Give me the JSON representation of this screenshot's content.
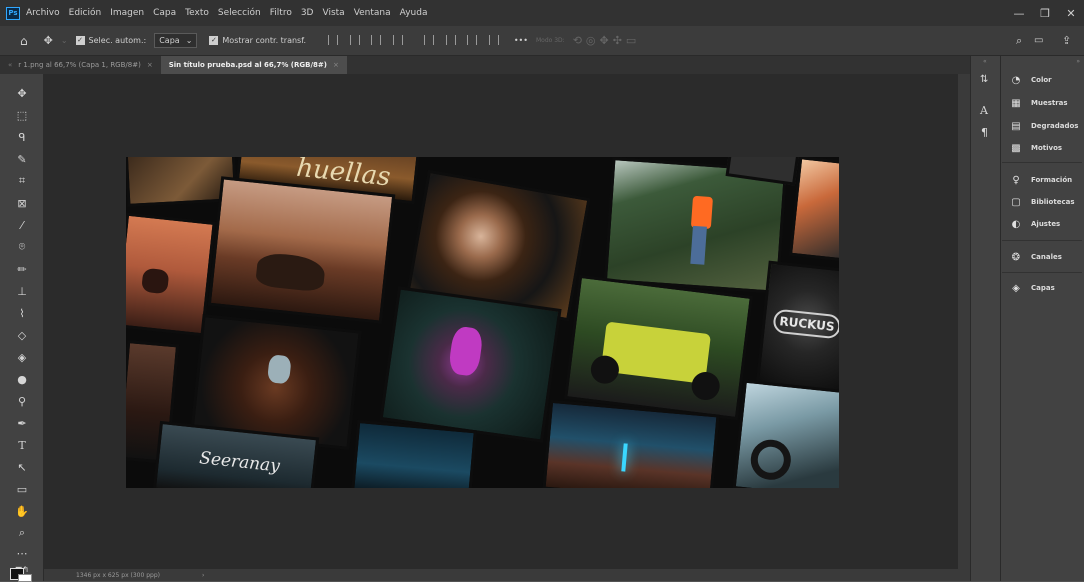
{
  "menu": [
    "Archivo",
    "Edición",
    "Imagen",
    "Capa",
    "Texto",
    "Selección",
    "Filtro",
    "3D",
    "Vista",
    "Ventana",
    "Ayuda"
  ],
  "app_logo": "Ps",
  "window_controls": {
    "minimize": "—",
    "restore": "❒",
    "close": "✕"
  },
  "options": {
    "auto_select_label": "Selec. autom.:",
    "auto_select_value": "Capa",
    "transform_label": "Mostrar contr. transf.",
    "mode_3d_label": "Modo 3D:",
    "more": "•••"
  },
  "tabs": [
    {
      "label": "r 1.png al 66,7% (Capa 1, RGB/8#)",
      "active": false
    },
    {
      "label": "Sin título prueba.psd al 66,7% (RGB/8#)",
      "active": true
    }
  ],
  "panels": {
    "color": "Color",
    "swatches": "Muestras",
    "gradients": "Degradados",
    "patterns": "Motivos",
    "paragraph": "Formación",
    "libraries": "Bibliotecas",
    "adjustments": "Ajustes",
    "channels": "Canales",
    "layers": "Capas"
  },
  "status": "1346 px x 625 px (300 ppp)",
  "status_arrow": "›",
  "collage_text": {
    "huellas": "huellas",
    "seeanay": "Seeranay",
    "ruckus": "RUCKUS"
  },
  "colors": {
    "accent": "#31a8ff",
    "menubar": "#323232",
    "canvas_bg": "#2b2b2b"
  }
}
